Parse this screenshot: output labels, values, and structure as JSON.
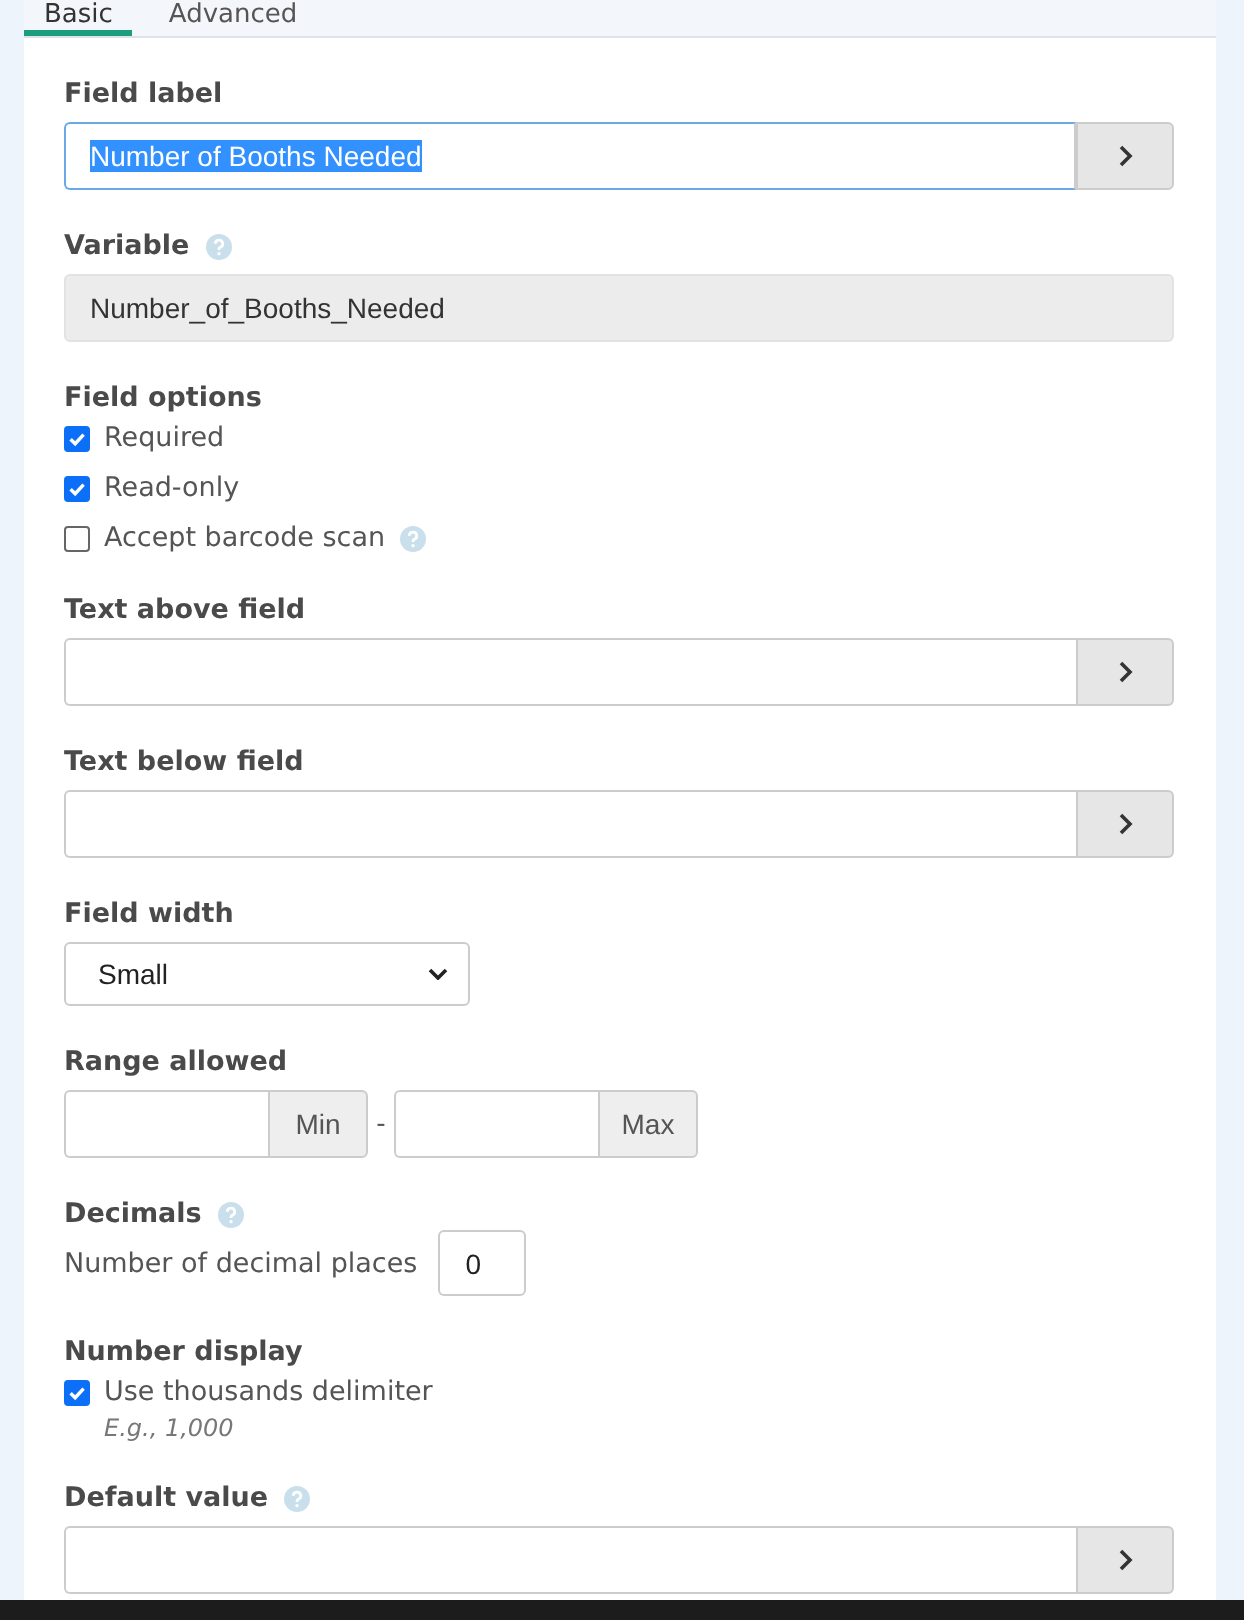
{
  "tabs": [
    {
      "label": "Basic",
      "selected": true
    },
    {
      "label": "Advanced",
      "selected": false
    }
  ],
  "sections": [
    {
      "kind": "text-field",
      "label": "Field label",
      "value": "Number of Booths Needed",
      "focused": true,
      "value_selected": true
    },
    {
      "kind": "readonly",
      "label": "Variable",
      "help": true,
      "value": "Number_of_Booths_Needed"
    },
    {
      "kind": "checkboxes",
      "label": "Field options",
      "options": [
        {
          "label": "Required",
          "checked": true
        },
        {
          "label": "Read-only",
          "checked": true
        },
        {
          "label": "Accept barcode scan",
          "checked": false,
          "help": true
        }
      ]
    },
    {
      "kind": "text-field",
      "label": "Text above field"
    },
    {
      "kind": "text-field",
      "label": "Text below field"
    },
    {
      "kind": "select",
      "label": "Field width",
      "value": "Small"
    },
    {
      "kind": "range",
      "label": "Range allowed",
      "min_addon": "Min",
      "separator": "-",
      "max_addon": "Max"
    },
    {
      "kind": "number",
      "label": "Decimals",
      "help": true,
      "prompt": "Number of decimal places",
      "value": "0"
    },
    {
      "kind": "checkboxes",
      "label": "Number display",
      "options": [
        {
          "label": "Use thousands delimiter",
          "checked": true,
          "hint": "E.g., 1,000"
        }
      ]
    },
    {
      "kind": "text-field",
      "label": "Default value",
      "help": true
    }
  ]
}
